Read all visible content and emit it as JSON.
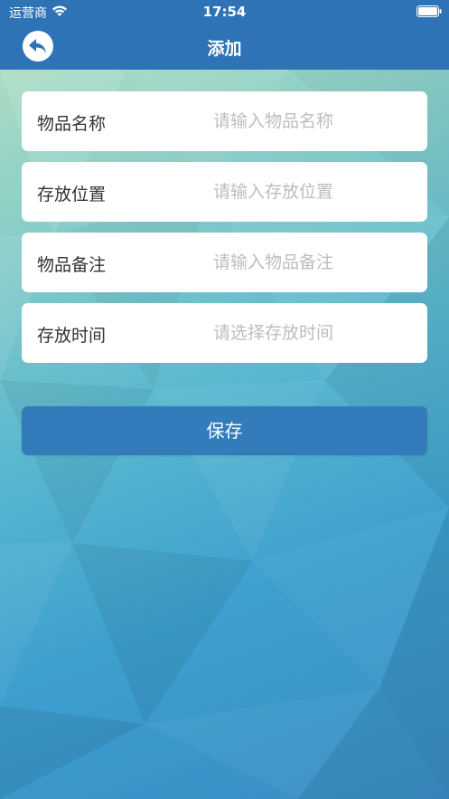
{
  "status_bar": {
    "carrier": "运营商",
    "time": "17:54"
  },
  "nav": {
    "title": "添加",
    "back_icon": "back-arrow-icon"
  },
  "form": {
    "fields": [
      {
        "label": "物品名称",
        "placeholder": "请输入物品名称",
        "value": ""
      },
      {
        "label": "存放位置",
        "placeholder": "请输入存放位置",
        "value": ""
      },
      {
        "label": "物品备注",
        "placeholder": "请输入物品备注",
        "value": ""
      },
      {
        "label": "存放时间",
        "placeholder": "请选择存放时间",
        "value": ""
      }
    ]
  },
  "save_button": {
    "label": "保存"
  },
  "colors": {
    "header": "#2e73b6",
    "button": "#327cbb",
    "placeholder": "#bdbdbd",
    "label": "#333333"
  }
}
